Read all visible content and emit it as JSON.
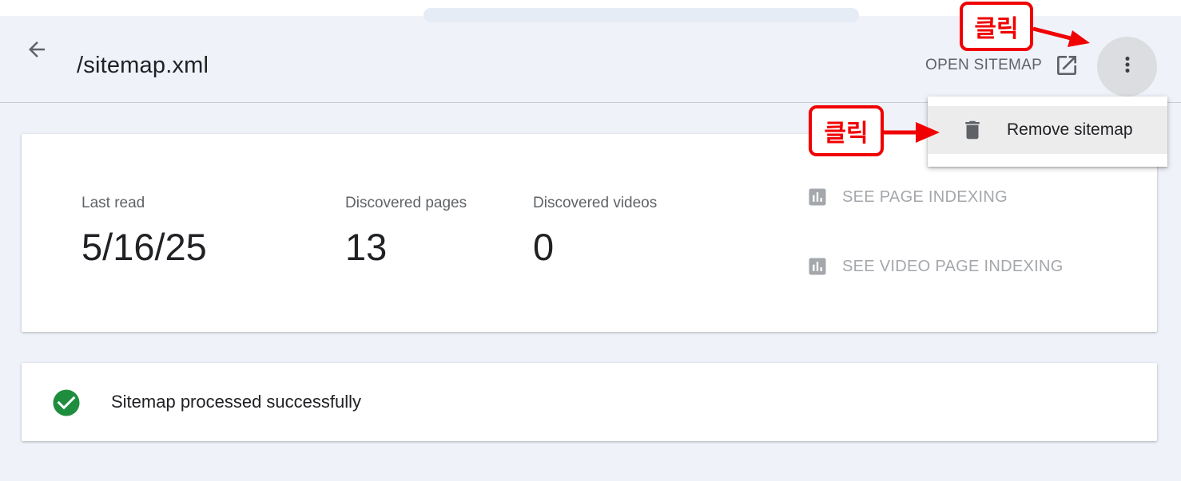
{
  "header": {
    "title": "/sitemap.xml",
    "open_sitemap_label": "OPEN SITEMAP"
  },
  "menu": {
    "items": [
      {
        "label": "Remove sitemap",
        "icon": "trash-icon"
      }
    ]
  },
  "stats": {
    "last_read": {
      "label": "Last read",
      "value": "5/16/25"
    },
    "discovered_pages": {
      "label": "Discovered pages",
      "value": "13"
    },
    "discovered_videos": {
      "label": "Discovered videos",
      "value": "0"
    }
  },
  "reports": {
    "page_indexing": "SEE PAGE INDEXING",
    "video_page_indexing": "SEE VIDEO PAGE INDEXING"
  },
  "status": {
    "text": "Sitemap processed successfully",
    "icon": "check-circle-icon",
    "color": "#1e8e3e"
  },
  "annotations": {
    "top_label": "클릭",
    "menu_label": "클릭",
    "color": "#f00000"
  },
  "colors": {
    "background": "#eff2f8",
    "card": "#ffffff",
    "muted_text": "#5f6368",
    "disabled_text": "#a4a7ab"
  }
}
